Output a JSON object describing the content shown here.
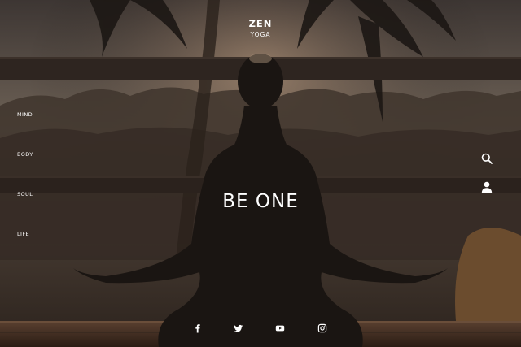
{
  "logo": {
    "main": "ZEN",
    "sub": "YOGA"
  },
  "nav": {
    "items": [
      {
        "label": "MIND"
      },
      {
        "label": "BODY"
      },
      {
        "label": "SOUL"
      },
      {
        "label": "LIFE"
      }
    ]
  },
  "hero": {
    "title": "BE ONE"
  },
  "actions": {
    "search_icon": "search-icon",
    "user_icon": "user-icon"
  },
  "social": {
    "icons": [
      "facebook-icon",
      "twitter-icon",
      "youtube-icon",
      "instagram-icon"
    ]
  },
  "colors": {
    "text": "#ffffff",
    "background_dark": "#2a2420",
    "sky_haze": "#6e5e50",
    "deck": "#3a2b22"
  }
}
